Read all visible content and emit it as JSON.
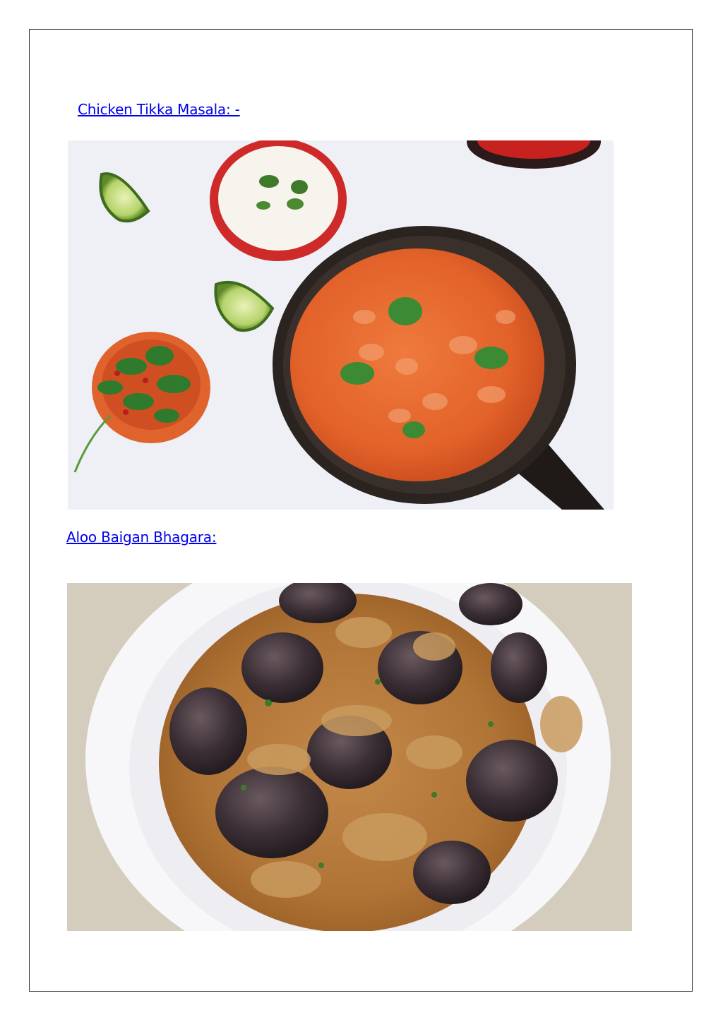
{
  "sections": [
    {
      "title": "Chicken Tikka Masala: -",
      "image_icon": "chicken-tikka-masala-photo"
    },
    {
      "title": "Aloo Baigan Bhagara:",
      "image_icon": "aloo-baigan-bhagara-photo"
    }
  ],
  "colors": {
    "link": "#0000ee",
    "border": "#333333",
    "curry_orange": "#e2622a",
    "pan_dark": "#2a2320",
    "eggplant": "#3b2f35",
    "gravy": "#b87a3c"
  }
}
